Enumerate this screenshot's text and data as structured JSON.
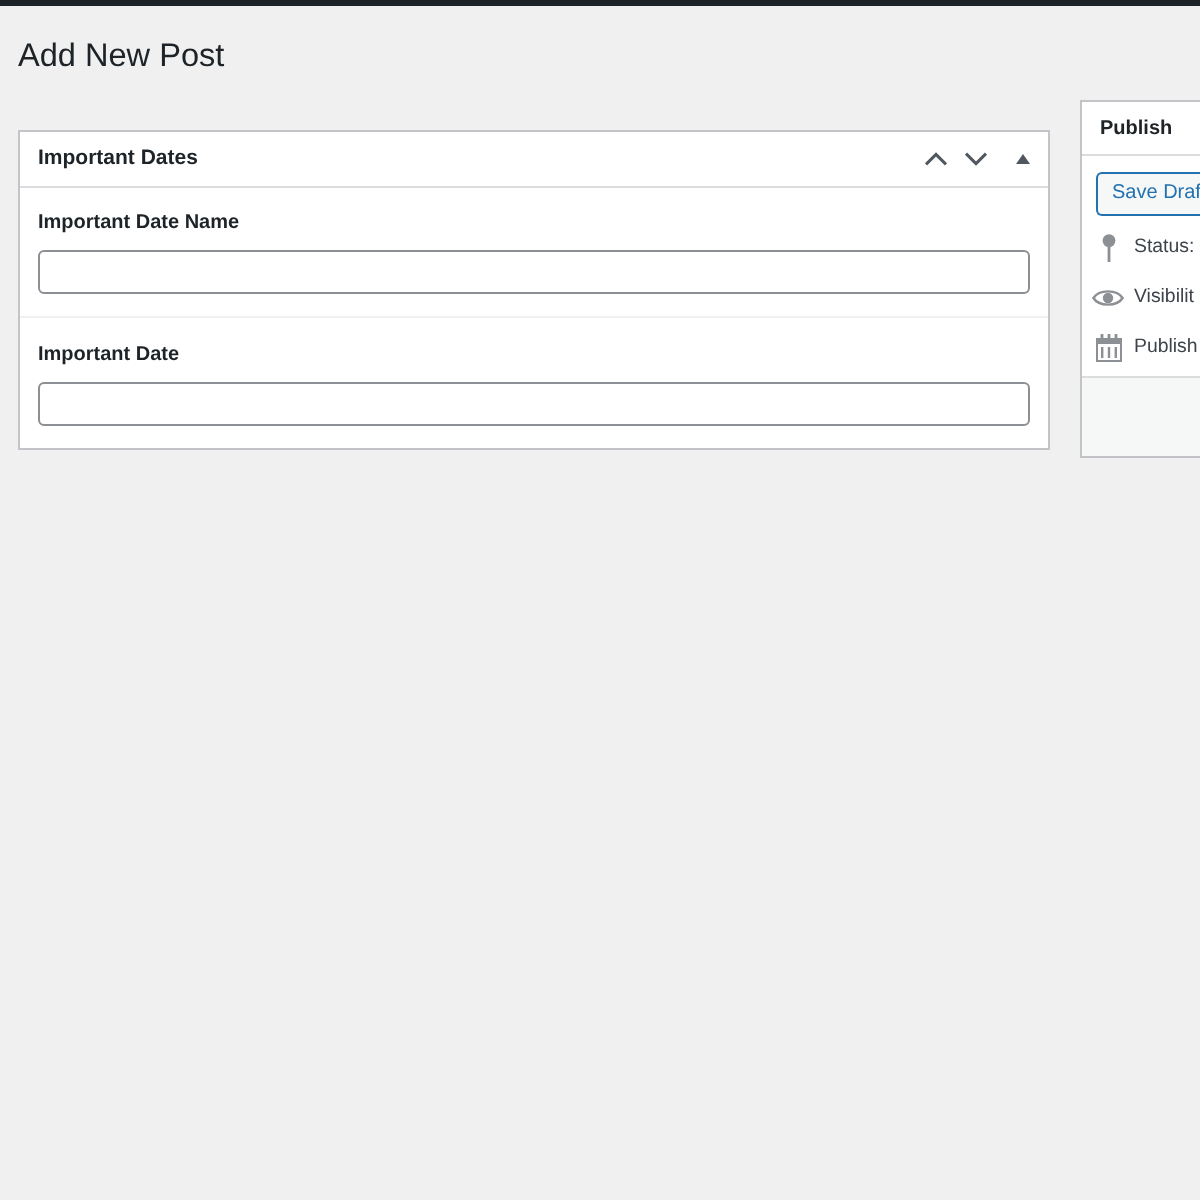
{
  "page": {
    "title": "Add New Post"
  },
  "meta_box": {
    "title": "Important Dates",
    "fields": [
      {
        "label": "Important Date Name"
      },
      {
        "label": "Important Date"
      }
    ]
  },
  "publish_box": {
    "title": "Publish",
    "button": "Save Draf",
    "rows": [
      {
        "label": "Status:"
      },
      {
        "label": "Visibilit"
      },
      {
        "label": "Publish"
      }
    ]
  }
}
